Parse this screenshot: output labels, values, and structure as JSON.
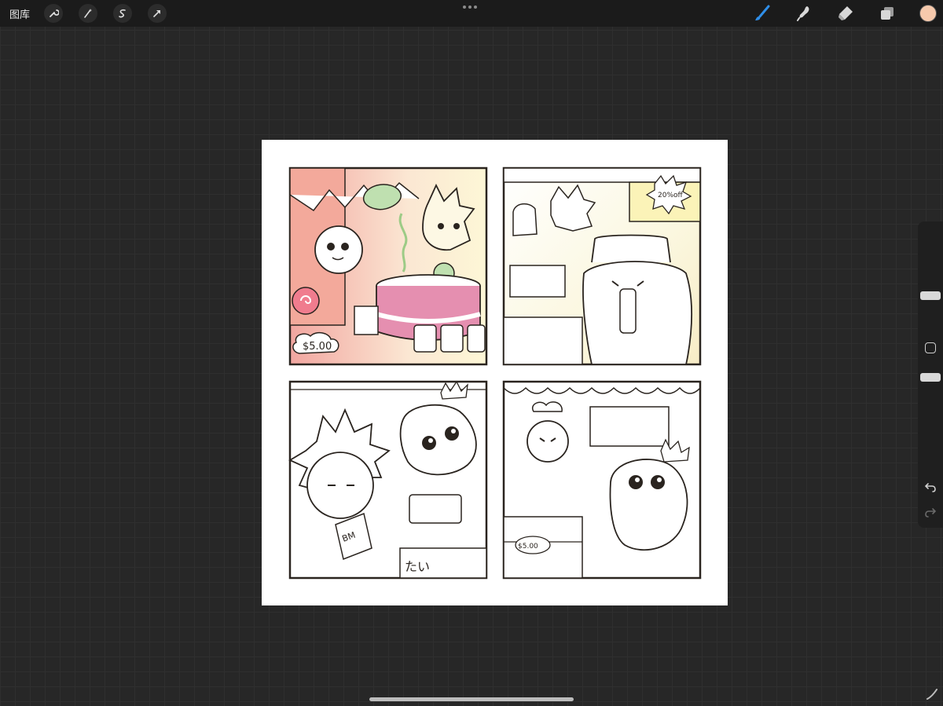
{
  "toolbar": {
    "gallery_label": "图库",
    "tools": [
      "wrench-icon",
      "magic-wand-icon",
      "selection-icon",
      "transform-arrow-icon"
    ],
    "right_tools": [
      "brush-icon",
      "smudge-icon",
      "eraser-icon",
      "layers-icon"
    ],
    "active_tool": "brush-icon"
  },
  "colors": {
    "active_color": "#f6c9ac",
    "brush_accent": "#2f8ee8"
  },
  "canvas": {
    "panels": [
      {
        "price_tag": "$5.00"
      },
      {
        "sale_badge": "20%off"
      },
      {
        "bag_text": "BM",
        "sign_text": "たい"
      },
      {
        "price_tag": "$5.00"
      }
    ]
  }
}
